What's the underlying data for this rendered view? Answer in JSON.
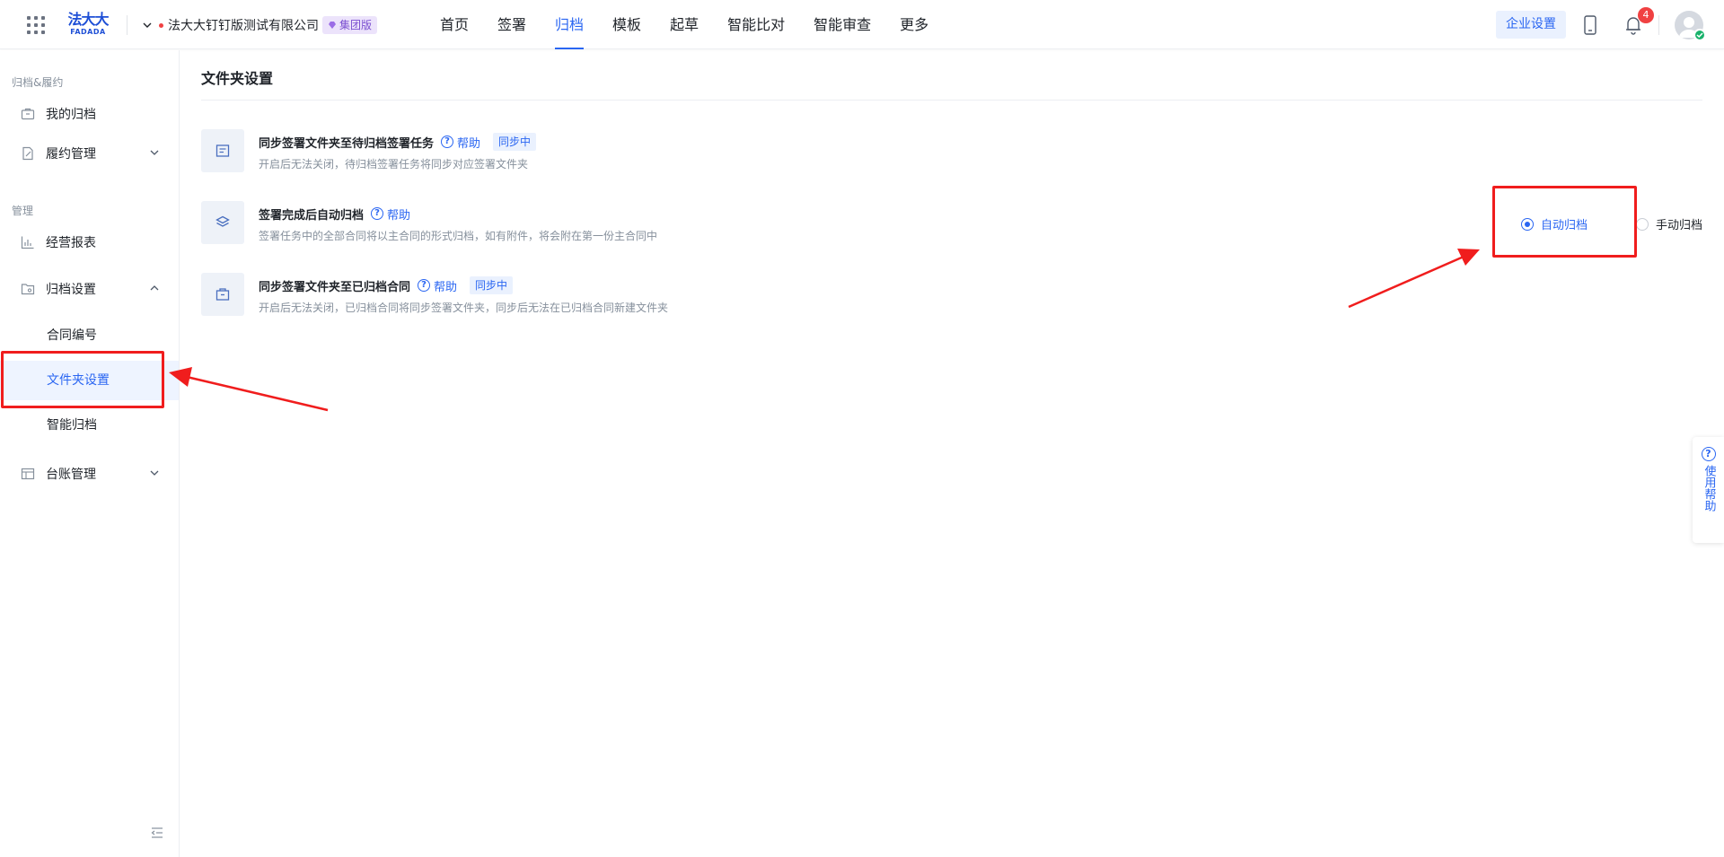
{
  "header": {
    "logo_cn": "法大大",
    "logo_en": "FADADA",
    "org_name": "法大大钉钉版测试有限公司",
    "org_badge": "集团版",
    "nav": [
      "首页",
      "签署",
      "归档",
      "模板",
      "起草",
      "智能比对",
      "智能审查",
      "更多"
    ],
    "active_nav": "归档",
    "enterprise_settings": "企业设置",
    "notification_count": "4",
    "accent_color": "#2a66f2"
  },
  "sidebar": {
    "section1": "归档&履约",
    "my_archive": "我的归档",
    "performance_mgmt": "履约管理",
    "section2": "管理",
    "business_report": "经营报表",
    "archive_settings": "归档设置",
    "sub_items": [
      "合同编号",
      "文件夹设置",
      "智能归档"
    ],
    "active_sub": "文件夹设置",
    "ledger_mgmt": "台账管理"
  },
  "main": {
    "page_title": "文件夹设置",
    "rows": [
      {
        "title": "同步签署文件夹至待归档签署任务",
        "help": "帮助",
        "status": "同步中",
        "desc": "开启后无法关闭，待归档签署任务将同步对应签署文件夹"
      },
      {
        "title": "签署完成后自动归档",
        "help": "帮助",
        "desc": "签署任务中的全部合同将以主合同的形式归档，如有附件，将会附在第一份主合同中",
        "options": [
          "自动归档",
          "手动归档"
        ],
        "selected": "自动归档"
      },
      {
        "title": "同步签署文件夹至已归档合同",
        "help": "帮助",
        "status": "同步中",
        "desc": "开启后无法关闭，已归档合同将同步签署文件夹，同步后无法在已归档合同新建文件夹"
      }
    ]
  },
  "float_help": "使用帮助"
}
